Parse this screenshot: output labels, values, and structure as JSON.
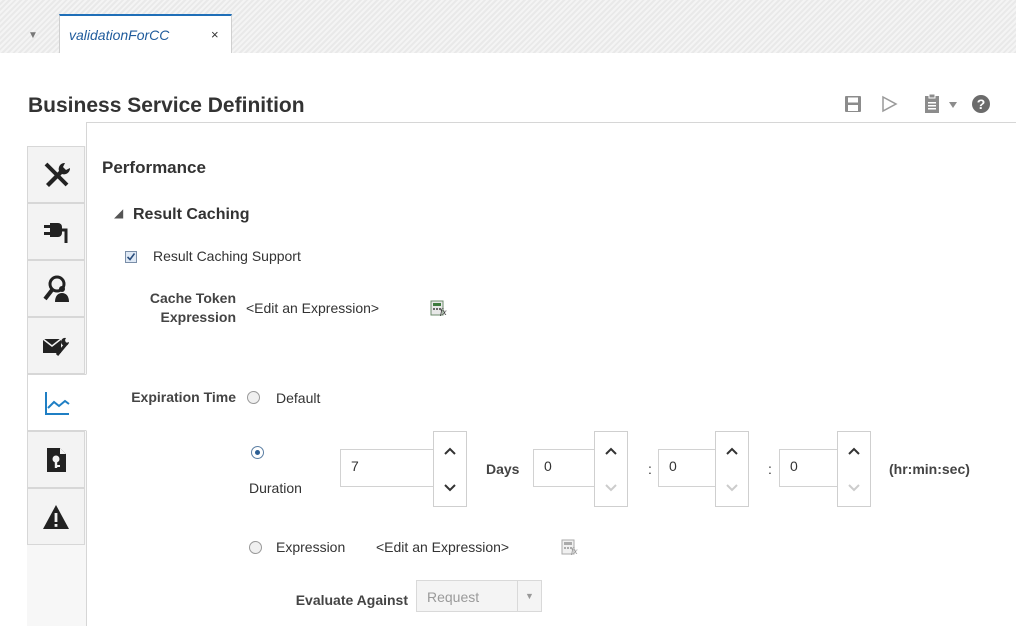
{
  "tab": {
    "label": "validationForCC",
    "close": "×",
    "menu": "▼"
  },
  "page": {
    "title": "Business Service Definition"
  },
  "toolbar": {
    "icons": [
      "save-icon",
      "run-icon",
      "clipboard-icon",
      "dropdown-icon",
      "help-icon"
    ]
  },
  "sidebar": {
    "items": [
      "tools-icon",
      "plug-icon",
      "user-search-icon",
      "message-config-icon",
      "performance-chart-icon",
      "key-document-icon",
      "warning-icon"
    ],
    "active_index": 4
  },
  "section": {
    "title": "Performance",
    "subsection": "Result Caching"
  },
  "result_caching": {
    "support_label": "Result Caching Support",
    "support_checked": true,
    "cache_token_label_line1": "Cache Token",
    "cache_token_label_line2": "Expression",
    "cache_token_value": "<Edit an Expression>"
  },
  "expiration": {
    "label": "Expiration Time",
    "default_label": "Default",
    "duration_label": "Duration",
    "days_value": "7",
    "days_label": "Days",
    "hours_value": "0",
    "minutes_value": "0",
    "seconds_value": "0",
    "separator": ":",
    "unit_label": "(hr:min:sec)",
    "expression_label": "Expression",
    "expression_value": "<Edit an Expression>",
    "selected": "Duration"
  },
  "evaluate": {
    "label": "Evaluate Against",
    "value": "Request"
  },
  "colors": {
    "accent": "#1f6fb8",
    "text": "#333333",
    "border": "#d6d6d6"
  }
}
